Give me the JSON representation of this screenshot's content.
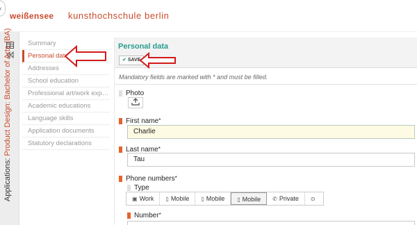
{
  "header": {
    "logo": "weißensee",
    "school": "kunsthochschule berlin",
    "corner": "‹"
  },
  "rail": {
    "icons": [
      "table-icon",
      "collapse-icon"
    ],
    "label_prefix": "Applications:",
    "label_program": "Product Design: Bachelor of Arts (BA)"
  },
  "nav": {
    "items": [
      {
        "label": "Summary",
        "active": false
      },
      {
        "label": "Personal data",
        "active": true
      },
      {
        "label": "Addresses",
        "active": false
      },
      {
        "label": "School education",
        "active": false
      },
      {
        "label": "Professional art/work exper...",
        "active": false
      },
      {
        "label": "Academic educations",
        "active": false
      },
      {
        "label": "Language skills",
        "active": false
      },
      {
        "label": "Application documents",
        "active": false
      },
      {
        "label": "Statutory declarations",
        "active": false
      }
    ]
  },
  "panel": {
    "title": "Personal data",
    "save_label": "SAVE",
    "cancel_label": "CANCEL",
    "mandatory_note": "Mandatory fields are marked with * and must be filled.",
    "photo_label": "Photo",
    "first_name_label": "First name",
    "first_name_value": "Charlie",
    "last_name_label": "Last name",
    "last_name_value": "Tau",
    "phone_label": "Phone numbers",
    "type_label": "Type",
    "number_label": "Number",
    "required_mark": "*",
    "phone_types": [
      {
        "label": "Work",
        "icon": "fax-icon",
        "selected": false
      },
      {
        "label": "Mobile",
        "icon": "mobile-icon",
        "selected": false
      },
      {
        "label": "Mobile",
        "icon": "mobile-icon",
        "selected": false
      },
      {
        "label": "Mobile",
        "icon": "mobile-icon",
        "selected": true
      },
      {
        "label": "Private",
        "icon": "phone-icon",
        "selected": false
      },
      {
        "label": "",
        "icon": "more-icon",
        "selected": false
      }
    ]
  },
  "colors": {
    "brand": "#c94a2b",
    "title_teal": "#2a9d8f",
    "required_marker": "#e8632b",
    "annotation_red": "#d11a1a"
  }
}
